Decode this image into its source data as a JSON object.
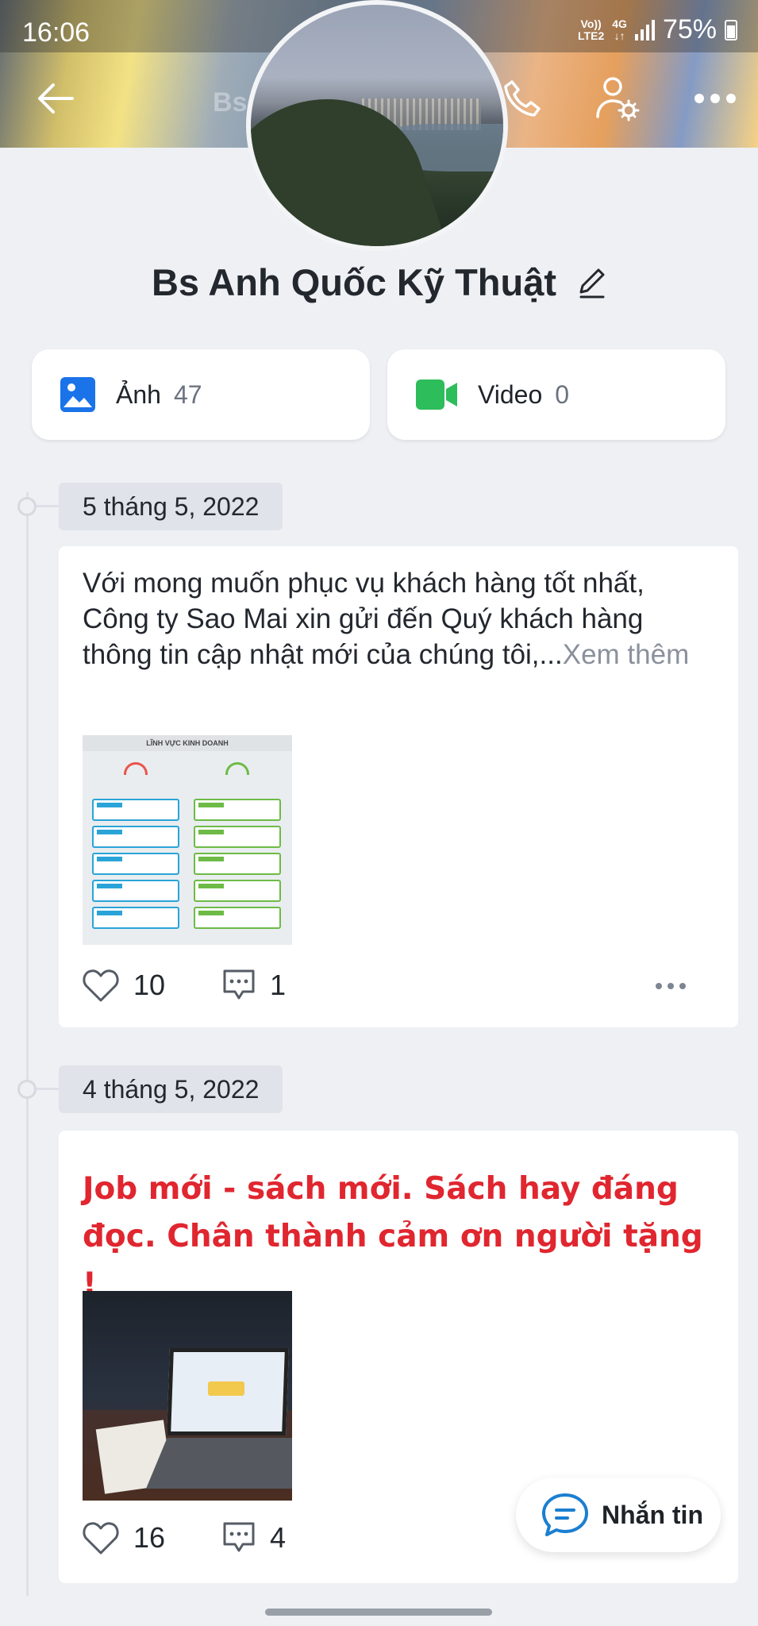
{
  "status_bar": {
    "time": "16:06",
    "network_top": "Vo))",
    "network_bottom": "LTE2",
    "net_type": "4G",
    "battery": "75%"
  },
  "header": {
    "title_ghost": "Bs Anh Quốc Kỹ"
  },
  "profile": {
    "name": "Bs Anh Quốc Kỹ Thuật"
  },
  "media": {
    "photo_label": "Ảnh",
    "photo_count": "47",
    "video_label": "Video",
    "video_count": "0",
    "photo_icon_color": "#1a73e8",
    "video_icon_color": "#2dbd5a"
  },
  "posts": [
    {
      "date": "5 tháng 5, 2022",
      "text": "Với mong muốn phục vụ khách hàng tốt nhất, Công ty Sao Mai xin gửi đến Quý khách hàng thông tin cập nhật mới của chúng tôi,...",
      "more": "Xem thêm",
      "image_title": "LĨNH VỰC KINH DOANH",
      "likes": "10",
      "comments": "1"
    },
    {
      "date": "4 tháng 5, 2022",
      "text": "Job mới - sách mới. Sách hay đáng đọc. Chân thành cảm ơn người tặng !",
      "likes": "16",
      "comments": "4"
    }
  ],
  "message_button": {
    "label": "Nhắn tin",
    "icon_color": "#1a7fd1"
  },
  "colors": {
    "accent_red": "#e0262f",
    "background": "#eef0f4"
  }
}
